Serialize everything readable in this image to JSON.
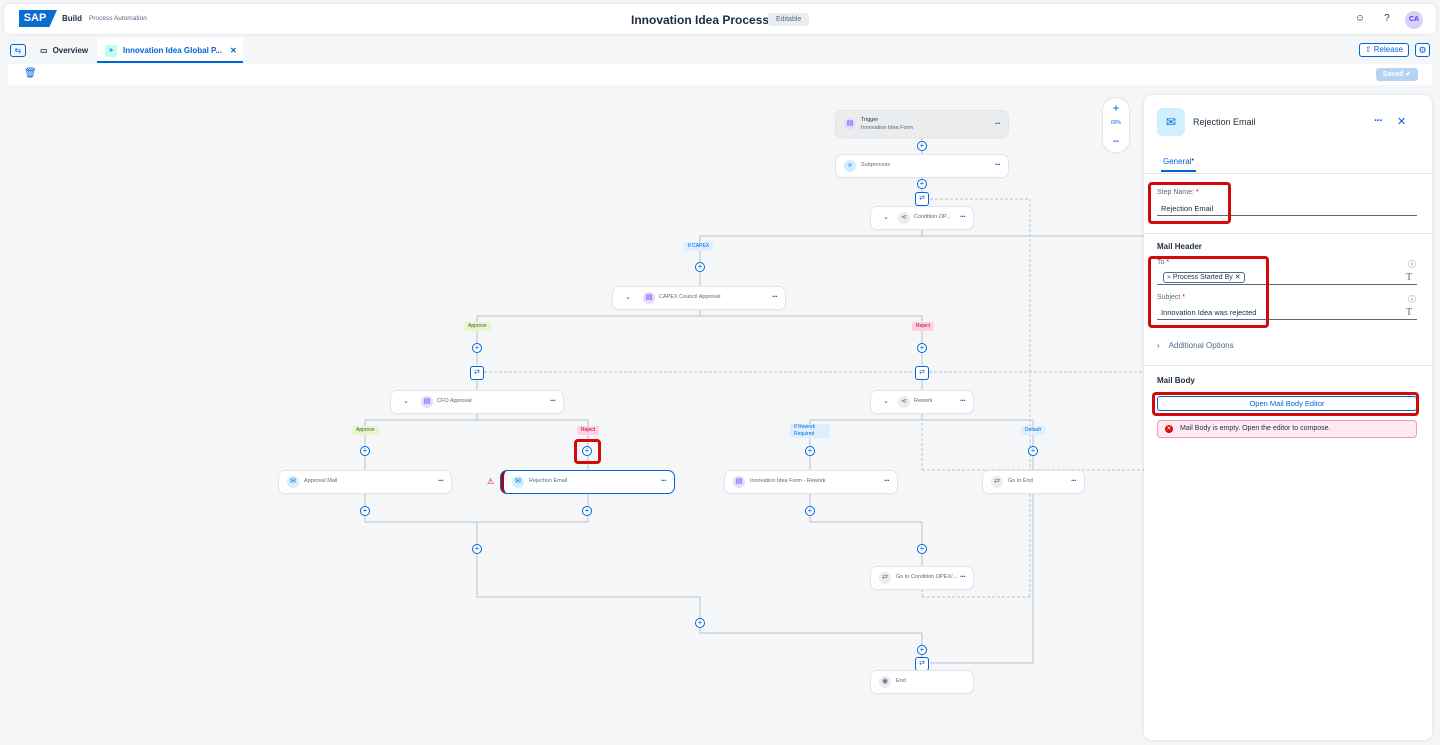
{
  "header": {
    "brand": "Build",
    "brand_sub": "Process Automation",
    "title": "Innovation Idea Process",
    "status": "Editable",
    "avatar": "CA"
  },
  "tabs": [
    {
      "label": "Overview"
    },
    {
      "label": "Innovation Idea Global P..."
    }
  ],
  "actions": {
    "release": "Release",
    "saved": "Saved"
  },
  "canvas": {
    "zoom": "69%",
    "nodes": {
      "trigger_title": "Trigger",
      "trigger_sub": "Innovation Idea Form",
      "subprocess": "Subprocess",
      "condition": "Condition OP...",
      "capex_approval": "CAPEX Council Approval",
      "cfo_approval": "CFO Approval",
      "rework": "Rework",
      "approval_mail": "Approval Mail",
      "rejection_email": "Rejection Email",
      "idea_rework": "Innovation Idea Form - Rework",
      "goto_end": "Go to End",
      "goto_condition": "Go to Condition OPEX/...",
      "end": "End"
    },
    "labels": {
      "if_capex": "If CAPEX",
      "approve": "Approve",
      "reject": "Reject",
      "if_rework": "If Rework Required",
      "default": "Default"
    }
  },
  "panel": {
    "title": "Rejection Email",
    "tab": "General",
    "step_name_label": "Step Name:",
    "step_name_value": "Rejection Email",
    "mail_header": "Mail Header",
    "to_label": "To",
    "to_token": "Process Started By",
    "subject_label": "Subject",
    "subject_value": "Innovation Idea was rejected",
    "additional_options": "Additional Options",
    "mail_body": "Mail Body",
    "open_editor": "Open Mail Body Editor",
    "error_message": "Mail Body is empty. Open the editor to compose."
  }
}
